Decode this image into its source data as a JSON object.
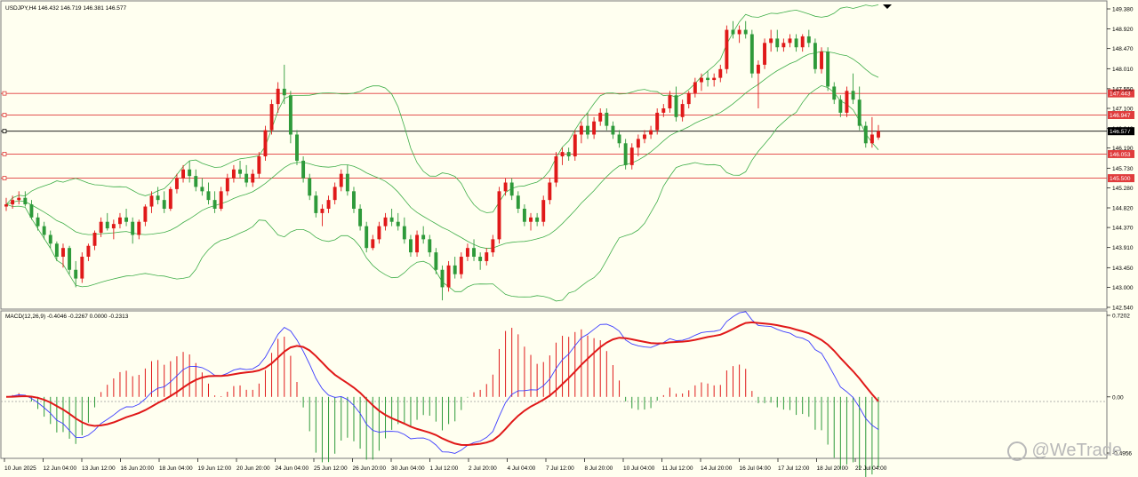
{
  "chart_data": [
    {
      "type": "candlestick",
      "title": "USDJPY,H4  146.432 146.719 146.381 146.577",
      "symbol": "USDJPY",
      "timeframe": "H4",
      "ohlc_last": {
        "open": 146.432,
        "high": 146.719,
        "low": 146.381,
        "close": 146.577
      },
      "ylim": [
        142.54,
        149.38
      ],
      "y_ticks": [
        "149.380",
        "148.920",
        "148.470",
        "148.010",
        "147.550",
        "147.100",
        "146.640",
        "146.190",
        "145.730",
        "145.280",
        "144.820",
        "144.370",
        "143.910",
        "143.450",
        "143.000",
        "142.540"
      ],
      "x_ticks": [
        "10 Jun 2025",
        "12 Jun 04:00",
        "13 Jun 12:00",
        "16 Jun 20:00",
        "18 Jun 04:00",
        "19 Jun 12:00",
        "20 Jun 20:00",
        "24 Jun 04:00",
        "25 Jun 12:00",
        "26 Jun 20:00",
        "30 Jun 04:00",
        "1 Jul 12:00",
        "2 Jul 20:00",
        "4 Jul 04:00",
        "7 Jul 12:00",
        "8 Jul 20:00",
        "10 Jul 04:00",
        "11 Jul 12:00",
        "14 Jul 20:00",
        "16 Jul 04:00",
        "17 Jul 12:00",
        "18 Jul 20:00",
        "22 Jul 04:00"
      ],
      "horizontal_levels": [
        {
          "value": 147.443,
          "label": "147.443",
          "color": "#e03c3c"
        },
        {
          "value": 146.947,
          "label": "146.947",
          "color": "#e03c3c"
        },
        {
          "value": 146.577,
          "label": "146.577",
          "color": "#000000"
        },
        {
          "value": 146.053,
          "label": "146.053",
          "color": "#e03c3c"
        },
        {
          "value": 145.5,
          "label": "145.500",
          "color": "#e03c3c"
        }
      ],
      "bollinger_bands": {
        "color": "#3fae49"
      },
      "candles_bull_color": "#e01919",
      "candles_bear_color": "#2e9a3a",
      "candles": [
        [
          144.85,
          145.05,
          144.75,
          144.9
        ],
        [
          144.9,
          145.1,
          144.8,
          145.0
        ],
        [
          145.0,
          145.2,
          144.9,
          145.05
        ],
        [
          145.05,
          145.2,
          144.85,
          144.9
        ],
        [
          144.9,
          145.0,
          144.55,
          144.6
        ],
        [
          144.6,
          144.7,
          144.3,
          144.4
        ],
        [
          144.4,
          144.5,
          144.1,
          144.2
        ],
        [
          144.2,
          144.3,
          143.9,
          144.0
        ],
        [
          144.0,
          144.05,
          143.6,
          143.7
        ],
        [
          143.7,
          144.0,
          143.45,
          143.9
        ],
        [
          143.9,
          143.95,
          143.3,
          143.4
        ],
        [
          143.4,
          143.6,
          143.0,
          143.2
        ],
        [
          143.2,
          143.8,
          143.1,
          143.7
        ],
        [
          143.7,
          144.0,
          143.6,
          143.95
        ],
        [
          143.95,
          144.3,
          143.85,
          144.25
        ],
        [
          144.25,
          144.6,
          144.15,
          144.5
        ],
        [
          144.5,
          144.7,
          144.3,
          144.35
        ],
        [
          144.35,
          144.55,
          144.1,
          144.45
        ],
        [
          144.45,
          144.7,
          144.35,
          144.6
        ],
        [
          144.6,
          144.8,
          144.4,
          144.5
        ],
        [
          144.5,
          144.6,
          144.0,
          144.2
        ],
        [
          144.2,
          144.55,
          144.1,
          144.5
        ],
        [
          144.5,
          144.9,
          144.4,
          144.85
        ],
        [
          144.85,
          145.2,
          144.7,
          145.1
        ],
        [
          145.1,
          145.3,
          144.9,
          145.0
        ],
        [
          145.0,
          145.2,
          144.7,
          144.8
        ],
        [
          144.8,
          145.3,
          144.75,
          145.25
        ],
        [
          145.25,
          145.6,
          145.15,
          145.5
        ],
        [
          145.5,
          145.8,
          145.4,
          145.7
        ],
        [
          145.7,
          145.9,
          145.4,
          145.55
        ],
        [
          145.55,
          145.7,
          145.2,
          145.3
        ],
        [
          145.3,
          145.5,
          145.1,
          145.2
        ],
        [
          145.2,
          145.4,
          144.9,
          145.0
        ],
        [
          145.0,
          145.2,
          144.7,
          144.8
        ],
        [
          144.8,
          145.3,
          144.75,
          145.2
        ],
        [
          145.2,
          145.6,
          145.1,
          145.5
        ],
        [
          145.5,
          145.8,
          145.4,
          145.7
        ],
        [
          145.7,
          145.9,
          145.5,
          145.6
        ],
        [
          145.6,
          145.8,
          145.3,
          145.4
        ],
        [
          145.4,
          145.7,
          145.3,
          145.6
        ],
        [
          145.6,
          146.1,
          145.5,
          146.0
        ],
        [
          146.0,
          146.7,
          145.9,
          146.6
        ],
        [
          146.6,
          147.3,
          146.5,
          147.2
        ],
        [
          147.2,
          147.7,
          147.0,
          147.55
        ],
        [
          147.55,
          148.1,
          147.2,
          147.4
        ],
        [
          147.4,
          147.5,
          146.3,
          146.5
        ],
        [
          146.5,
          146.6,
          145.8,
          145.9
        ],
        [
          145.9,
          146.0,
          145.4,
          145.5
        ],
        [
          145.5,
          145.6,
          145.0,
          145.1
        ],
        [
          145.1,
          145.2,
          144.6,
          144.7
        ],
        [
          144.7,
          144.9,
          144.4,
          144.8
        ],
        [
          144.8,
          145.1,
          144.7,
          145.0
        ],
        [
          145.0,
          145.4,
          144.9,
          145.3
        ],
        [
          145.3,
          145.7,
          145.2,
          145.6
        ],
        [
          145.6,
          145.8,
          145.1,
          145.2
        ],
        [
          145.2,
          145.3,
          144.7,
          144.8
        ],
        [
          144.8,
          144.9,
          144.3,
          144.4
        ],
        [
          144.4,
          144.5,
          143.8,
          143.9
        ],
        [
          143.9,
          144.2,
          143.85,
          144.1
        ],
        [
          144.1,
          144.5,
          144.0,
          144.4
        ],
        [
          144.4,
          144.7,
          144.3,
          144.6
        ],
        [
          144.6,
          144.8,
          144.4,
          144.5
        ],
        [
          144.5,
          144.7,
          144.3,
          144.4
        ],
        [
          144.4,
          144.6,
          144.0,
          144.1
        ],
        [
          144.1,
          144.2,
          143.7,
          143.8
        ],
        [
          143.8,
          144.3,
          143.7,
          144.2
        ],
        [
          144.2,
          144.4,
          144.0,
          144.1
        ],
        [
          144.1,
          144.2,
          143.7,
          143.8
        ],
        [
          143.8,
          143.9,
          143.3,
          143.4
        ],
        [
          143.4,
          143.5,
          142.7,
          143.0
        ],
        [
          143.0,
          143.6,
          142.9,
          143.5
        ],
        [
          143.5,
          143.7,
          143.2,
          143.3
        ],
        [
          143.3,
          143.8,
          143.2,
          143.7
        ],
        [
          143.7,
          144.0,
          143.6,
          143.9
        ],
        [
          143.9,
          144.1,
          143.6,
          143.7
        ],
        [
          143.7,
          143.8,
          143.4,
          143.6
        ],
        [
          143.6,
          143.9,
          143.5,
          143.8
        ],
        [
          143.8,
          144.2,
          143.7,
          144.1
        ],
        [
          144.1,
          145.3,
          144.0,
          145.2
        ],
        [
          145.2,
          145.5,
          145.1,
          145.4
        ],
        [
          145.4,
          145.5,
          145.0,
          145.1
        ],
        [
          145.1,
          145.2,
          144.7,
          144.8
        ],
        [
          144.8,
          144.9,
          144.4,
          144.5
        ],
        [
          144.5,
          144.7,
          144.3,
          144.6
        ],
        [
          144.6,
          144.7,
          144.4,
          144.5
        ],
        [
          144.5,
          145.1,
          144.4,
          145.0
        ],
        [
          145.0,
          145.5,
          144.9,
          145.4
        ],
        [
          145.4,
          146.1,
          145.3,
          146.0
        ],
        [
          146.0,
          146.2,
          145.8,
          146.1
        ],
        [
          146.1,
          146.2,
          145.9,
          146.0
        ],
        [
          146.0,
          146.6,
          145.9,
          146.5
        ],
        [
          146.5,
          146.8,
          146.3,
          146.7
        ],
        [
          146.7,
          147.0,
          146.4,
          146.5
        ],
        [
          146.5,
          146.9,
          146.4,
          146.8
        ],
        [
          146.8,
          147.1,
          146.7,
          147.0
        ],
        [
          147.0,
          147.1,
          146.6,
          146.7
        ],
        [
          146.7,
          146.8,
          146.4,
          146.5
        ],
        [
          146.5,
          146.6,
          146.2,
          146.3
        ],
        [
          146.3,
          146.4,
          145.7,
          145.8
        ],
        [
          145.8,
          146.3,
          145.7,
          146.2
        ],
        [
          146.2,
          146.5,
          146.0,
          146.4
        ],
        [
          146.4,
          146.6,
          146.3,
          146.5
        ],
        [
          146.5,
          146.7,
          146.4,
          146.6
        ],
        [
          146.6,
          147.1,
          146.5,
          147.0
        ],
        [
          147.0,
          147.2,
          146.9,
          147.1
        ],
        [
          147.1,
          147.5,
          147.0,
          147.4
        ],
        [
          147.4,
          147.6,
          146.8,
          146.9
        ],
        [
          146.9,
          147.3,
          146.8,
          147.2
        ],
        [
          147.2,
          147.5,
          147.1,
          147.45
        ],
        [
          147.45,
          147.8,
          147.35,
          147.7
        ],
        [
          147.7,
          147.9,
          147.5,
          147.8
        ],
        [
          147.8,
          147.95,
          147.6,
          147.75
        ],
        [
          147.75,
          147.9,
          147.6,
          147.8
        ],
        [
          147.8,
          148.1,
          147.7,
          148.0
        ],
        [
          148.0,
          149.0,
          147.9,
          148.9
        ],
        [
          148.9,
          149.1,
          148.7,
          148.8
        ],
        [
          148.8,
          149.0,
          148.6,
          148.9
        ],
        [
          148.9,
          149.1,
          148.7,
          148.8
        ],
        [
          148.8,
          148.9,
          147.8,
          147.9
        ],
        [
          147.9,
          148.2,
          147.1,
          148.1
        ],
        [
          148.1,
          148.7,
          148.0,
          148.6
        ],
        [
          148.6,
          148.9,
          148.4,
          148.7
        ],
        [
          148.7,
          148.9,
          148.4,
          148.5
        ],
        [
          148.5,
          148.7,
          148.4,
          148.6
        ],
        [
          148.6,
          148.8,
          148.5,
          148.7
        ],
        [
          148.7,
          148.8,
          148.4,
          148.5
        ],
        [
          148.5,
          148.8,
          148.4,
          148.75
        ],
        [
          148.75,
          148.9,
          148.5,
          148.6
        ],
        [
          148.6,
          148.7,
          147.9,
          148.0
        ],
        [
          148.0,
          148.5,
          147.9,
          148.4
        ],
        [
          148.4,
          148.5,
          147.5,
          147.6
        ],
        [
          147.6,
          147.7,
          147.2,
          147.3
        ],
        [
          147.3,
          147.4,
          146.9,
          147.0
        ],
        [
          147.0,
          147.6,
          146.9,
          147.5
        ],
        [
          147.5,
          147.9,
          147.2,
          147.3
        ],
        [
          147.3,
          147.6,
          146.6,
          146.7
        ],
        [
          146.7,
          146.8,
          146.2,
          146.3
        ],
        [
          146.3,
          146.9,
          146.2,
          146.5
        ],
        [
          146.432,
          146.719,
          146.381,
          146.577
        ]
      ]
    },
    {
      "type": "macd",
      "title": "MACD(12,26,9) -0.4046 -0.2267 0.0000 -0.2313",
      "params": "12,26,9",
      "values_shown": [
        -0.4046,
        -0.2267,
        0.0,
        -0.2313
      ],
      "ylim": [
        -0.4956,
        0.7202
      ],
      "y_ticks": [
        "0.7202",
        "0.00",
        "-0.4956"
      ],
      "macd_color": "#3d3dff",
      "signal_color": "#e01919",
      "hist_up_color": "#e01919",
      "hist_down_color": "#2e9a3a"
    }
  ],
  "watermark": "@WeTrade"
}
